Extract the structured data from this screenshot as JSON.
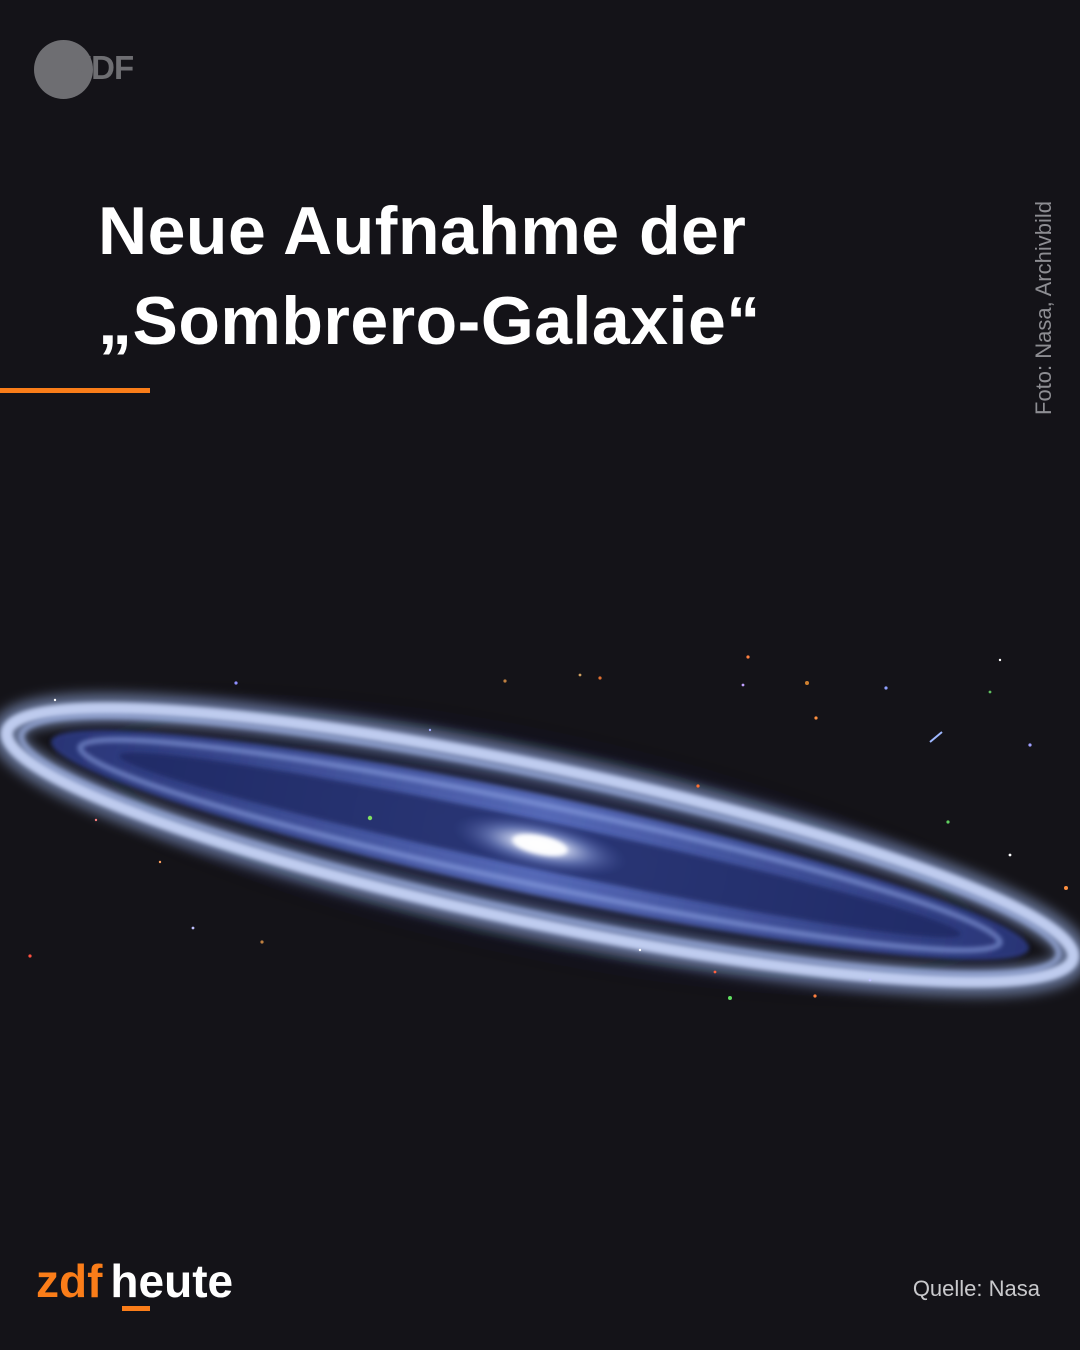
{
  "logo": {
    "icon": "zdf-logo-icon",
    "text": "ZDF"
  },
  "headline": {
    "line1": "Neue Aufnahme der",
    "line2": "„Sombrero-Galaxie“"
  },
  "photo_credit": "Foto: Nasa, Archivbild",
  "image": {
    "icon": "sombrero-galaxy-image"
  },
  "brand": {
    "part1": "zdf",
    "part2": "heute"
  },
  "source": "Quelle: Nasa",
  "colors": {
    "background": "#141318",
    "accent": "#fa7d19",
    "text": "#ffffff",
    "muted": "#8d8d92"
  }
}
